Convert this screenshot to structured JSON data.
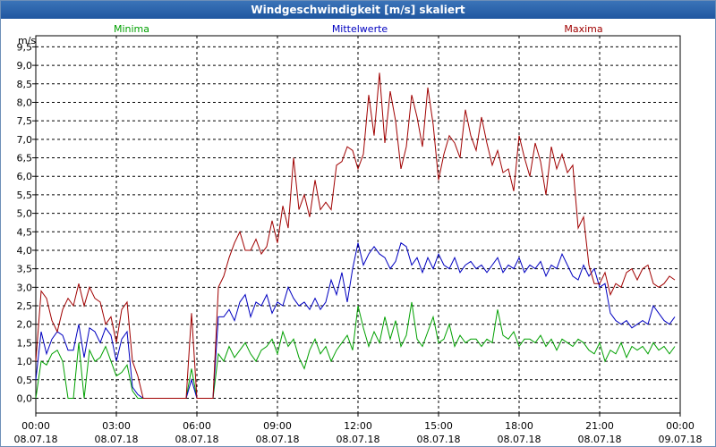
{
  "window": {
    "title": "Windgeschwindigkeit [m/s] skaliert"
  },
  "chart_data": {
    "type": "line",
    "title": "Windgeschwindigkeit [m/s] skaliert",
    "ylabel": "m/s",
    "xlabel": "",
    "ylim": [
      -0.4,
      9.8
    ],
    "xlim": [
      0,
      24
    ],
    "grid": true,
    "legend_position": "top",
    "y_ticks": [
      "0,0",
      "0,5",
      "1,0",
      "1,5",
      "2,0",
      "2,5",
      "3,0",
      "3,5",
      "4,0",
      "4,5",
      "5,0",
      "5,5",
      "6,0",
      "6,5",
      "7,0",
      "7,5",
      "8,0",
      "8,5",
      "9,0",
      "9,5"
    ],
    "x_ticks": [
      {
        "time": "00:00",
        "date": "08.07.18"
      },
      {
        "time": "03:00",
        "date": "08.07.18"
      },
      {
        "time": "06:00",
        "date": "08.07.18"
      },
      {
        "time": "09:00",
        "date": "08.07.18"
      },
      {
        "time": "12:00",
        "date": "08.07.18"
      },
      {
        "time": "15:00",
        "date": "08.07.18"
      },
      {
        "time": "18:00",
        "date": "08.07.18"
      },
      {
        "time": "21:00",
        "date": "08.07.18"
      },
      {
        "time": "00:00",
        "date": "09.07.18"
      }
    ],
    "x": [
      0,
      0.2,
      0.4,
      0.6,
      0.8,
      1,
      1.2,
      1.4,
      1.6,
      1.8,
      2,
      2.2,
      2.4,
      2.6,
      2.8,
      3,
      3.2,
      3.4,
      3.6,
      3.8,
      4,
      4.2,
      4.4,
      4.6,
      4.8,
      5,
      5.2,
      5.4,
      5.6,
      5.8,
      6,
      6.2,
      6.4,
      6.6,
      6.8,
      7,
      7.2,
      7.4,
      7.6,
      7.8,
      8,
      8.2,
      8.4,
      8.6,
      8.8,
      9,
      9.2,
      9.4,
      9.6,
      9.8,
      10,
      10.2,
      10.4,
      10.6,
      10.8,
      11,
      11.2,
      11.4,
      11.6,
      11.8,
      12,
      12.2,
      12.4,
      12.6,
      12.8,
      13,
      13.2,
      13.4,
      13.6,
      13.8,
      14,
      14.2,
      14.4,
      14.6,
      14.8,
      15,
      15.2,
      15.4,
      15.6,
      15.8,
      16,
      16.2,
      16.4,
      16.6,
      16.8,
      17,
      17.2,
      17.4,
      17.6,
      17.8,
      18,
      18.2,
      18.4,
      18.6,
      18.8,
      19,
      19.2,
      19.4,
      19.6,
      19.8,
      20,
      20.2,
      20.4,
      20.6,
      20.8,
      21,
      21.2,
      21.4,
      21.6,
      21.8,
      22,
      22.2,
      22.4,
      22.6,
      22.8,
      23,
      23.2,
      23.4,
      23.6,
      23.8
    ],
    "series": [
      {
        "name": "Minima",
        "color": "#00a000",
        "values": [
          0,
          1.0,
          0.9,
          1.2,
          1.3,
          1.0,
          0.0,
          0.0,
          1.5,
          0.0,
          1.3,
          1.0,
          1.1,
          1.4,
          1.0,
          0.6,
          0.7,
          0.9,
          0.2,
          0.0,
          0.0,
          0.0,
          0.0,
          0.0,
          0.0,
          0.0,
          0.0,
          0.0,
          0.0,
          0.8,
          0.0,
          0.0,
          0.0,
          0.0,
          1.2,
          1.0,
          1.4,
          1.1,
          1.3,
          1.5,
          1.2,
          1.0,
          1.3,
          1.4,
          1.6,
          1.2,
          1.8,
          1.4,
          1.6,
          1.1,
          0.8,
          1.3,
          1.6,
          1.2,
          1.4,
          1.0,
          1.3,
          1.5,
          1.7,
          1.3,
          2.5,
          1.9,
          1.4,
          1.8,
          1.5,
          2.2,
          1.6,
          2.1,
          1.4,
          1.7,
          2.6,
          1.6,
          1.4,
          1.8,
          2.2,
          1.5,
          1.6,
          2.0,
          1.4,
          1.7,
          1.5,
          1.6,
          1.6,
          1.4,
          1.6,
          1.5,
          2.4,
          1.7,
          1.6,
          1.8,
          1.4,
          1.6,
          1.6,
          1.5,
          1.7,
          1.4,
          1.6,
          1.3,
          1.6,
          1.5,
          1.4,
          1.6,
          1.5,
          1.3,
          1.2,
          1.5,
          1.0,
          1.3,
          1.2,
          1.5,
          1.1,
          1.4,
          1.3,
          1.4,
          1.2,
          1.5,
          1.3,
          1.4,
          1.2,
          1.4
        ]
      },
      {
        "name": "Mittelwerte",
        "color": "#0000c0",
        "values": [
          0.5,
          1.8,
          1.2,
          1.6,
          1.8,
          1.7,
          1.3,
          1.3,
          2.0,
          1.1,
          1.9,
          1.8,
          1.5,
          1.9,
          1.7,
          1.0,
          1.6,
          1.8,
          0.3,
          0.1,
          0.0,
          0.0,
          0.0,
          0.0,
          0.0,
          0.0,
          0.0,
          0.0,
          0.0,
          0.5,
          0.0,
          0.0,
          0.0,
          0.0,
          2.2,
          2.2,
          2.4,
          2.1,
          2.6,
          2.8,
          2.2,
          2.6,
          2.5,
          2.8,
          2.3,
          2.6,
          2.5,
          3.0,
          2.7,
          2.5,
          2.6,
          2.4,
          2.7,
          2.4,
          2.6,
          3.2,
          2.8,
          3.4,
          2.6,
          3.5,
          4.2,
          3.6,
          3.9,
          4.1,
          3.9,
          3.8,
          3.5,
          3.7,
          4.2,
          4.1,
          3.6,
          3.8,
          3.4,
          3.8,
          3.5,
          3.9,
          3.6,
          3.5,
          3.8,
          3.4,
          3.6,
          3.7,
          3.5,
          3.6,
          3.4,
          3.6,
          3.8,
          3.4,
          3.6,
          3.5,
          3.8,
          3.4,
          3.6,
          3.5,
          3.7,
          3.3,
          3.6,
          3.5,
          3.9,
          3.6,
          3.3,
          3.2,
          3.6,
          3.3,
          3.5,
          3.0,
          3.1,
          2.3,
          2.1,
          2.0,
          2.1,
          1.9,
          2.0,
          2.1,
          2.0,
          2.5,
          2.3,
          2.1,
          2.0,
          2.2
        ]
      },
      {
        "name": "Maxima",
        "color": "#a00000",
        "values": [
          1.0,
          2.9,
          2.7,
          2.1,
          1.8,
          2.4,
          2.7,
          2.5,
          3.1,
          2.5,
          3.0,
          2.7,
          2.6,
          2.0,
          2.2,
          1.5,
          2.4,
          2.6,
          1.0,
          0.6,
          0.0,
          0.0,
          0.0,
          0.0,
          0.0,
          0.0,
          0.0,
          0.0,
          0.0,
          2.3,
          0.0,
          0.0,
          0.0,
          0.0,
          3.0,
          3.3,
          3.8,
          4.2,
          4.5,
          4.0,
          4.0,
          4.3,
          3.9,
          4.1,
          4.8,
          4.2,
          5.2,
          4.6,
          6.5,
          5.1,
          5.5,
          4.9,
          5.9,
          5.1,
          5.3,
          5.1,
          6.3,
          6.4,
          6.8,
          6.7,
          6.2,
          6.6,
          8.2,
          7.1,
          8.8,
          6.9,
          8.3,
          7.5,
          6.2,
          6.8,
          8.2,
          7.6,
          6.8,
          8.4,
          7.4,
          5.9,
          6.6,
          7.1,
          6.9,
          6.5,
          7.8,
          7.1,
          6.7,
          7.6,
          6.9,
          6.3,
          6.7,
          6.1,
          6.2,
          5.6,
          7.1,
          6.5,
          6.0,
          6.9,
          6.4,
          5.5,
          6.8,
          6.2,
          6.6,
          6.1,
          6.3,
          4.6,
          4.9,
          3.6,
          3.1,
          3.1,
          3.4,
          2.8,
          3.1,
          3.0,
          3.4,
          3.5,
          3.2,
          3.5,
          3.6,
          3.1,
          3.0,
          3.1,
          3.3,
          3.2
        ]
      }
    ]
  }
}
